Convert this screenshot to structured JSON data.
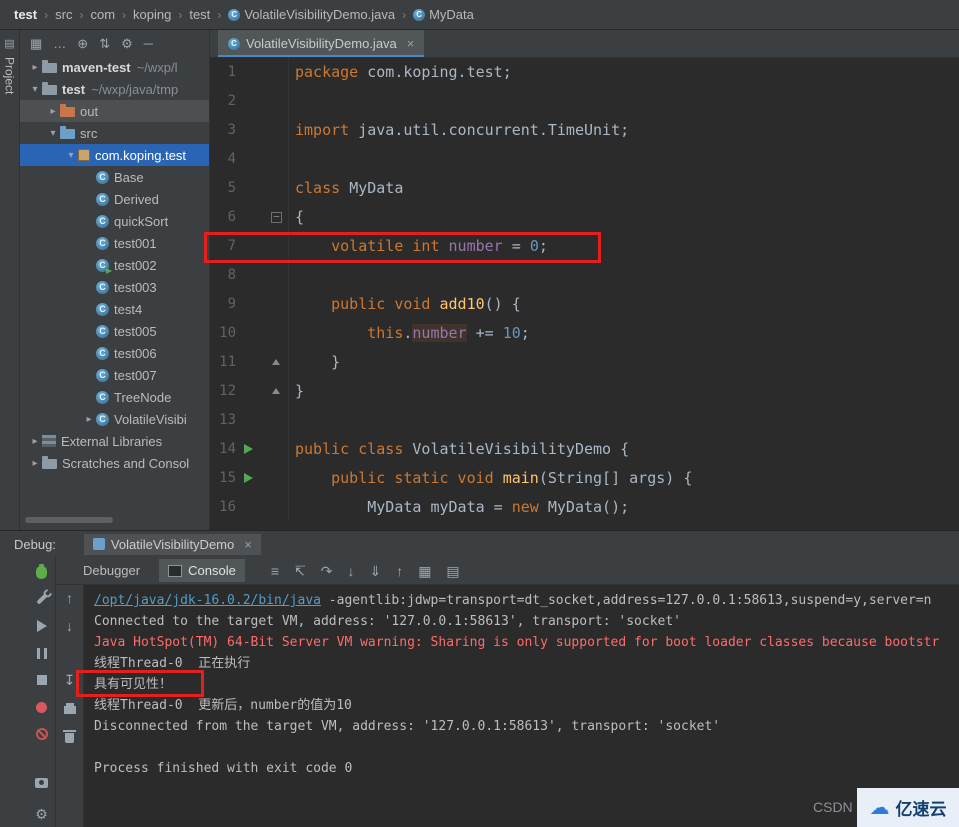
{
  "icons": {
    "class_letter": "C",
    "fold_minus": "–",
    "stripe_glyph": "▤"
  },
  "annotations": {
    "color": "#e3201d",
    "boxes": [
      "editor-line-7-volatile",
      "console-visibility-line"
    ]
  },
  "breadcrumbs": {
    "separator": "›",
    "items": [
      {
        "label": "test",
        "bold": true
      },
      {
        "label": "src"
      },
      {
        "label": "com"
      },
      {
        "label": "koping"
      },
      {
        "label": "test"
      },
      {
        "label": "VolatileVisibilityDemo.java",
        "icon": "class"
      },
      {
        "label": "MyData",
        "icon": "class"
      }
    ]
  },
  "stripe": {
    "label": "Project"
  },
  "project": {
    "toolbar_icons": [
      {
        "name": "show-views-icon",
        "glyph": "▦"
      },
      {
        "name": "more-options-icon",
        "glyph": "…"
      },
      {
        "name": "select-opened-file-icon",
        "glyph": "⊕"
      },
      {
        "name": "collapse-all-icon",
        "glyph": "⇅"
      },
      {
        "name": "settings-icon",
        "glyph": "⚙"
      },
      {
        "name": "hide-panel-icon",
        "glyph": "─"
      }
    ],
    "tree": [
      {
        "label": "maven-test",
        "path": "~/wxp/l",
        "level": 0,
        "chevron": "▸",
        "icon": "project",
        "bold": true
      },
      {
        "label": "test",
        "path": "~/wxp/java/tmp",
        "level": 0,
        "chevron": "▾",
        "icon": "project",
        "bold": true
      },
      {
        "label": "out",
        "level": 1,
        "chevron": "▸",
        "icon": "folder-out",
        "rowbg": "hov"
      },
      {
        "label": "src",
        "level": 1,
        "chevron": "▾",
        "icon": "folder-src"
      },
      {
        "label": "com.koping.test",
        "level": 2,
        "chevron": "▾",
        "icon": "package",
        "selected": true
      },
      {
        "label": "Base",
        "level": 3,
        "icon": "class"
      },
      {
        "label": "Derived",
        "level": 3,
        "icon": "class"
      },
      {
        "label": "quickSort",
        "level": 3,
        "icon": "class"
      },
      {
        "label": "test001",
        "level": 3,
        "icon": "class"
      },
      {
        "label": "test002",
        "level": 3,
        "icon": "class-run"
      },
      {
        "label": "test003",
        "level": 3,
        "icon": "class"
      },
      {
        "label": "test4",
        "level": 3,
        "icon": "class"
      },
      {
        "label": "test005",
        "level": 3,
        "icon": "class"
      },
      {
        "label": "test006",
        "level": 3,
        "icon": "class"
      },
      {
        "label": "test007",
        "level": 3,
        "icon": "class"
      },
      {
        "label": "TreeNode",
        "level": 3,
        "icon": "class"
      },
      {
        "label": "VolatileVisibi",
        "level": 3,
        "chevron": "▸",
        "icon": "class"
      },
      {
        "label": "External Libraries",
        "level": 0,
        "chevron": "▸",
        "icon": "library"
      },
      {
        "label": "Scratches and Consol",
        "level": 0,
        "chevron": "▸",
        "icon": "scratches"
      }
    ]
  },
  "editor": {
    "tab": {
      "label": "VolatileVisibilityDemo.java",
      "close": "×"
    },
    "colors": {
      "keyword": "#cc7832",
      "plain": "#a9b7c6",
      "number": "#6897bb",
      "field": "#9876aa",
      "method": "#ffc66d"
    },
    "lines": [
      {
        "n": "1",
        "seg": [
          {
            "t": "package ",
            "c": "kw"
          },
          {
            "t": "com.koping.test;",
            "c": "pl"
          }
        ]
      },
      {
        "n": "2",
        "seg": []
      },
      {
        "n": "3",
        "seg": [
          {
            "t": "import ",
            "c": "kw"
          },
          {
            "t": "java.util.concurrent.TimeUnit;",
            "c": "pl"
          }
        ]
      },
      {
        "n": "4",
        "seg": []
      },
      {
        "n": "5",
        "seg": [
          {
            "t": "class ",
            "c": "kw"
          },
          {
            "t": "MyData",
            "c": "pl"
          }
        ]
      },
      {
        "n": "6",
        "fold": "minus",
        "seg": [
          {
            "t": "{",
            "c": "pl"
          }
        ]
      },
      {
        "n": "7",
        "seg": [
          {
            "t": "    ",
            "c": "pl"
          },
          {
            "t": "volatile int ",
            "c": "kw"
          },
          {
            "t": "number",
            "c": "fld"
          },
          {
            "t": " = ",
            "c": "pl"
          },
          {
            "t": "0",
            "c": "num"
          },
          {
            "t": ";",
            "c": "pl"
          }
        ]
      },
      {
        "n": "8",
        "seg": []
      },
      {
        "n": "9",
        "seg": [
          {
            "t": "    ",
            "c": "pl"
          },
          {
            "t": "public void ",
            "c": "kw"
          },
          {
            "t": "add10",
            "c": "mth"
          },
          {
            "t": "() {",
            "c": "pl"
          }
        ]
      },
      {
        "n": "10",
        "seg": [
          {
            "t": "        ",
            "c": "pl"
          },
          {
            "t": "this",
            "c": "kw"
          },
          {
            "t": ".",
            "c": "pl"
          },
          {
            "t": "number",
            "c": "fldhl"
          },
          {
            "t": " += ",
            "c": "pl"
          },
          {
            "t": "10",
            "c": "num"
          },
          {
            "t": ";",
            "c": "pl"
          }
        ]
      },
      {
        "n": "11",
        "fold": "end",
        "seg": [
          {
            "t": "    }",
            "c": "pl"
          }
        ]
      },
      {
        "n": "12",
        "fold": "end",
        "seg": [
          {
            "t": "}",
            "c": "pl"
          }
        ]
      },
      {
        "n": "13",
        "seg": []
      },
      {
        "n": "14",
        "run": true,
        "seg": [
          {
            "t": "public class ",
            "c": "kw"
          },
          {
            "t": "VolatileVisibilityDemo {",
            "c": "pl"
          }
        ]
      },
      {
        "n": "15",
        "run": true,
        "seg": [
          {
            "t": "    ",
            "c": "pl"
          },
          {
            "t": "public static void ",
            "c": "kw"
          },
          {
            "t": "main",
            "c": "mth"
          },
          {
            "t": "(String[] args) {",
            "c": "pl"
          }
        ]
      },
      {
        "n": "16",
        "seg": [
          {
            "t": "        MyData myData = ",
            "c": "pl"
          },
          {
            "t": "new ",
            "c": "kw"
          },
          {
            "t": "MyData();",
            "c": "pl"
          }
        ]
      }
    ]
  },
  "debug": {
    "label": "Debug:",
    "tab": {
      "label": "VolatileVisibilityDemo",
      "close": "×"
    },
    "tabs": [
      {
        "label": "Debugger",
        "selected": false
      },
      {
        "label": "Console",
        "selected": true
      }
    ],
    "toolbar_icons": [
      {
        "name": "layout-settings-icon",
        "glyph": "≡"
      },
      {
        "name": "show-execution-point-icon",
        "glyph": "↸"
      },
      {
        "name": "step-over-icon",
        "glyph": "↷"
      },
      {
        "name": "step-into-icon",
        "glyph": "↓"
      },
      {
        "name": "force-step-into-icon",
        "glyph": "⇓"
      },
      {
        "name": "step-out-icon",
        "glyph": "↑"
      },
      {
        "name": "evaluate-expression-icon",
        "glyph": "▦"
      },
      {
        "name": "restore-layout-icon",
        "glyph": "▤"
      }
    ],
    "left_icons": [
      {
        "name": "rerun-debug-icon",
        "shape": "bug"
      },
      {
        "name": "debug-settings-icon",
        "shape": "wrench"
      },
      {
        "name": "resume-program-icon",
        "shape": "resume"
      },
      {
        "name": "pause-program-icon",
        "shape": "pause"
      },
      {
        "name": "stop-program-icon",
        "shape": "stop"
      },
      {
        "name": "view-breakpoints-icon",
        "shape": "dot"
      },
      {
        "name": "mute-breakpoints-icon",
        "shape": "mute"
      },
      {
        "name": "thread-dump-icon",
        "shape": "camera",
        "pin": "a"
      },
      {
        "name": "debugger-gear-icon",
        "glyph": "⚙",
        "pin": "b"
      }
    ],
    "console_icons": [
      {
        "name": "up-stack-icon",
        "glyph": "↑"
      },
      {
        "name": "down-stack-icon",
        "glyph": "↓"
      },
      {
        "name": "scroll-to-end-icon",
        "glyph": "↧",
        "gap": true
      },
      {
        "name": "print-icon",
        "shape": "print"
      },
      {
        "name": "clear-console-icon",
        "shape": "trash"
      }
    ],
    "console_lines": [
      {
        "segments": [
          {
            "t": "/opt/java/jdk-16.0.2/bin/java",
            "c": "link"
          },
          {
            "t": " -agentlib:jdwp=transport=dt_socket,address=127.0.0.1:58613,suspend=y,server=n",
            "c": "pl"
          }
        ]
      },
      {
        "segments": [
          {
            "t": "Connected to the target VM, address: '127.0.0.1:58613', transport: 'socket'",
            "c": "pl"
          }
        ]
      },
      {
        "segments": [
          {
            "t": "Java HotSpot(TM) 64-Bit Server VM warning: Sharing is only supported for boot loader classes because bootstr",
            "c": "err"
          }
        ]
      },
      {
        "segments": [
          {
            "t": "线程Thread-0  正在执行",
            "c": "pl"
          }
        ]
      },
      {
        "segments": [
          {
            "t": "具有可见性！",
            "c": "pl"
          }
        ]
      },
      {
        "segments": [
          {
            "t": "线程Thread-0  更新后，number的值为10",
            "c": "pl"
          }
        ]
      },
      {
        "segments": [
          {
            "t": "Disconnected from the target VM, address: '127.0.0.1:58613', transport: 'socket'",
            "c": "pl"
          }
        ]
      },
      {
        "segments": [
          {
            "t": "",
            "c": "pl"
          }
        ]
      },
      {
        "segments": [
          {
            "t": "Process finished with exit code 0",
            "c": "pl"
          }
        ]
      }
    ]
  },
  "watermark": {
    "csdn": "CSDN",
    "badge": "亿速云",
    "cloud_glyph": "☁"
  }
}
